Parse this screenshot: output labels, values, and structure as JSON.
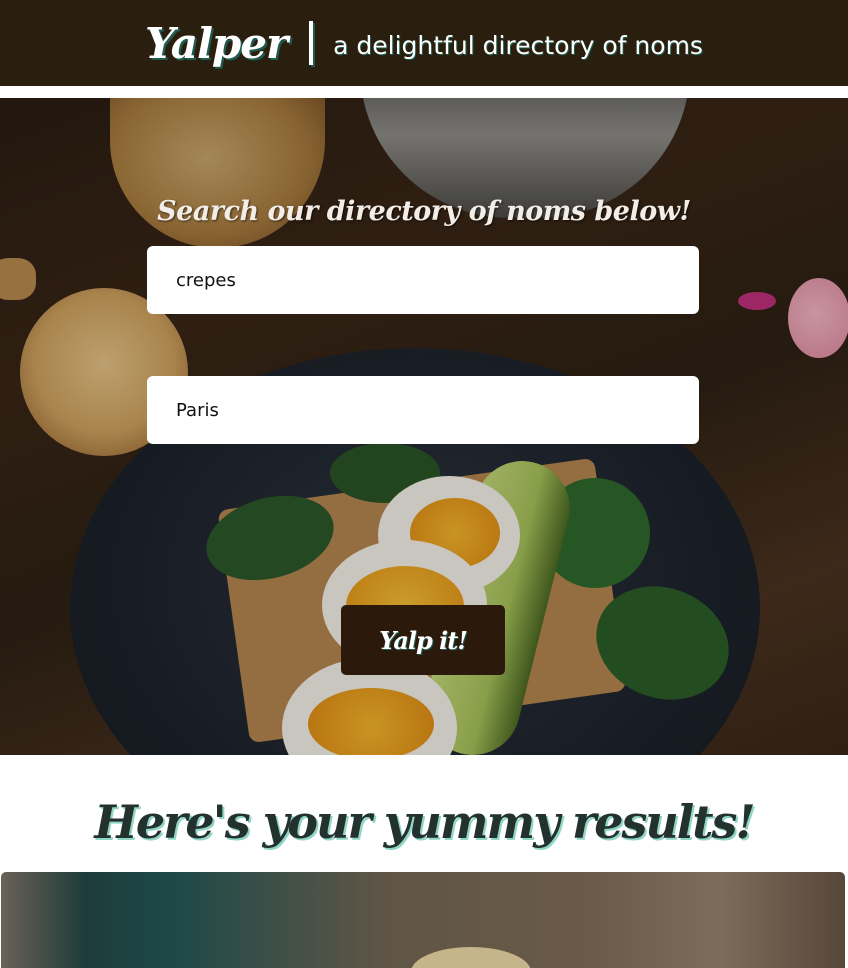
{
  "header": {
    "brand": "Yalper",
    "tagline": "a delightful directory of noms"
  },
  "search": {
    "heading": "Search our directory of noms below!",
    "term_value": "crepes",
    "location_value": "Paris",
    "submit_label": "Yalp it!"
  },
  "results": {
    "heading": "Here's your yummy results!"
  },
  "colors": {
    "header_bg": "#2a1f0e",
    "button_bg": "#2b1a0c",
    "accent_shadow": "#8fd6c6"
  }
}
